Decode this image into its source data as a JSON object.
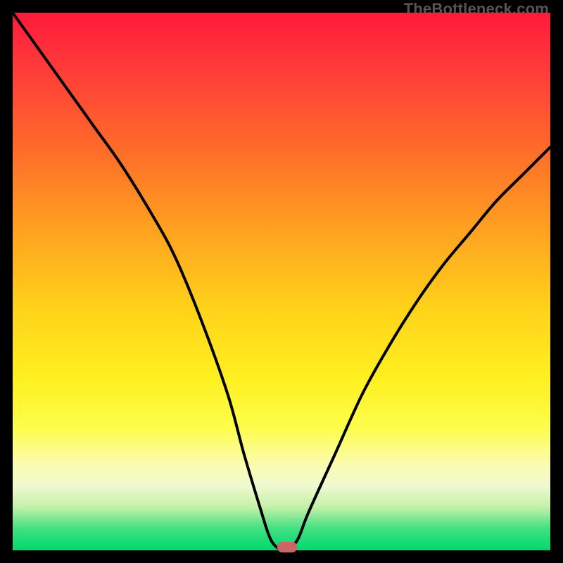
{
  "watermark": "TheBottleneck.com",
  "colors": {
    "curve": "#000000",
    "marker": "#c66262",
    "frame": "#000000"
  },
  "chart_data": {
    "type": "line",
    "title": "",
    "xlabel": "",
    "ylabel": "",
    "xlim": [
      0,
      100
    ],
    "ylim": [
      0,
      100
    ],
    "x": [
      0,
      5,
      10,
      15,
      20,
      25,
      30,
      35,
      40,
      43,
      46,
      48,
      50,
      51,
      53,
      55,
      60,
      65,
      70,
      75,
      80,
      85,
      90,
      95,
      100
    ],
    "values": [
      100,
      93,
      86,
      79,
      72,
      64,
      55,
      43,
      29,
      18,
      8,
      2,
      0,
      0,
      2,
      7,
      18,
      29,
      38,
      46,
      53,
      59,
      65,
      70,
      75
    ],
    "marker": {
      "x": 51,
      "y": 0
    },
    "grid": false,
    "legend": false
  }
}
